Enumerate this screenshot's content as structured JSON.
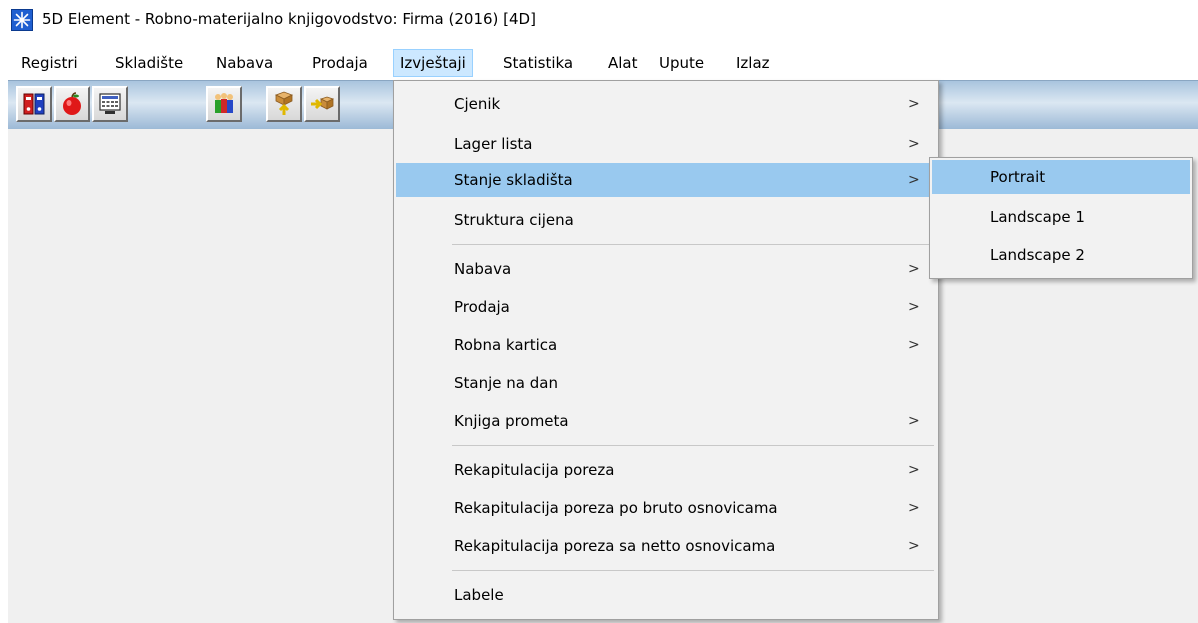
{
  "window": {
    "title": "5D Element - Robno-materijalno knjigovodstvo: Firma (2016) [4D]",
    "icon": "asterisk-star-icon"
  },
  "menubar": {
    "items": [
      "Registri",
      "Skladište",
      "Nabava",
      "Prodaja",
      "Izvještaji",
      "Statistika",
      "Alat",
      "Upute",
      "Izlaz"
    ],
    "active": "Izvještaji"
  },
  "toolbar": {
    "buttons": [
      {
        "icon": "binders-icon"
      },
      {
        "icon": "apple-icon"
      },
      {
        "icon": "calculator-icon"
      },
      {
        "icon": "people-icon"
      },
      {
        "icon": "box-up-arrow-icon"
      },
      {
        "icon": "box-right-arrow-icon"
      }
    ]
  },
  "dropdown": {
    "items": [
      {
        "label": "Cjenik",
        "submenu": true
      },
      {
        "label": "Lager lista",
        "submenu": true
      },
      {
        "label": "Stanje skladišta",
        "submenu": true,
        "highlighted": true
      },
      {
        "label": "Struktura cijena",
        "submenu": false
      },
      {
        "label": "Nabava",
        "submenu": true
      },
      {
        "label": "Prodaja",
        "submenu": true
      },
      {
        "label": "Robna kartica",
        "submenu": true
      },
      {
        "label": "Stanje na dan",
        "submenu": false
      },
      {
        "label": "Knjiga prometa",
        "submenu": true
      },
      {
        "label": "Rekapitulacija poreza",
        "submenu": true
      },
      {
        "label": "Rekapitulacija poreza po bruto osnovicama",
        "submenu": true
      },
      {
        "label": "Rekapitulacija poreza sa netto osnovicama",
        "submenu": true
      },
      {
        "label": "Labele",
        "submenu": false
      }
    ],
    "arrow": ">"
  },
  "submenu": {
    "items": [
      {
        "label": "Portrait",
        "highlighted": true
      },
      {
        "label": "Landscape 1"
      },
      {
        "label": "Landscape 2"
      }
    ]
  },
  "colors": {
    "highlight": "#99c9ef",
    "menu_active": "#cce8ff",
    "workspace": "#f0f0f0"
  }
}
